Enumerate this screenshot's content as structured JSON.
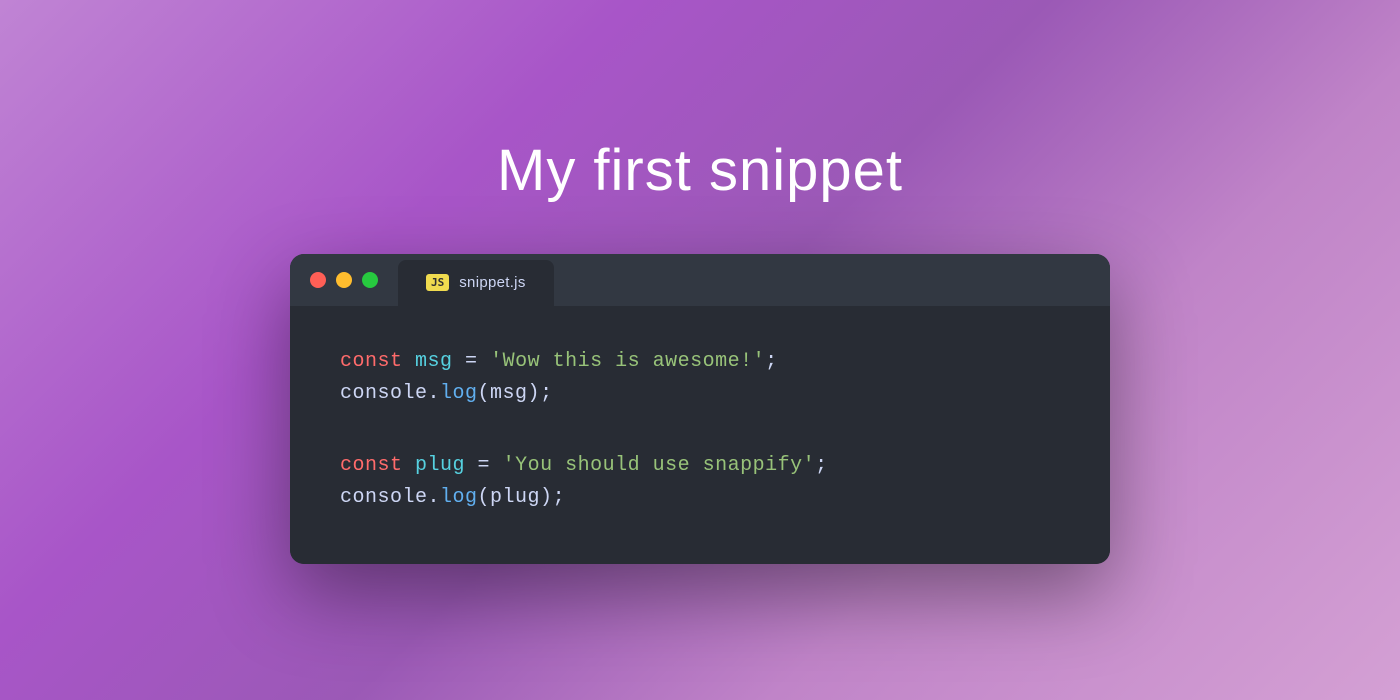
{
  "page": {
    "title": "My first snippet",
    "background_gradient_start": "#c084d4",
    "background_gradient_end": "#9b59b6"
  },
  "editor": {
    "tab": {
      "js_badge": "JS",
      "filename": "snippet.js"
    },
    "traffic_lights": {
      "close_color": "#ff5f56",
      "minimize_color": "#ffbd2e",
      "maximize_color": "#27c93f"
    },
    "code_blocks": [
      {
        "line1": "const msg = 'Wow this is awesome!';",
        "line2": "console.log(msg);"
      },
      {
        "line1": "const plug = 'You should use snappify';",
        "line2": "console.log(plug);"
      }
    ]
  }
}
